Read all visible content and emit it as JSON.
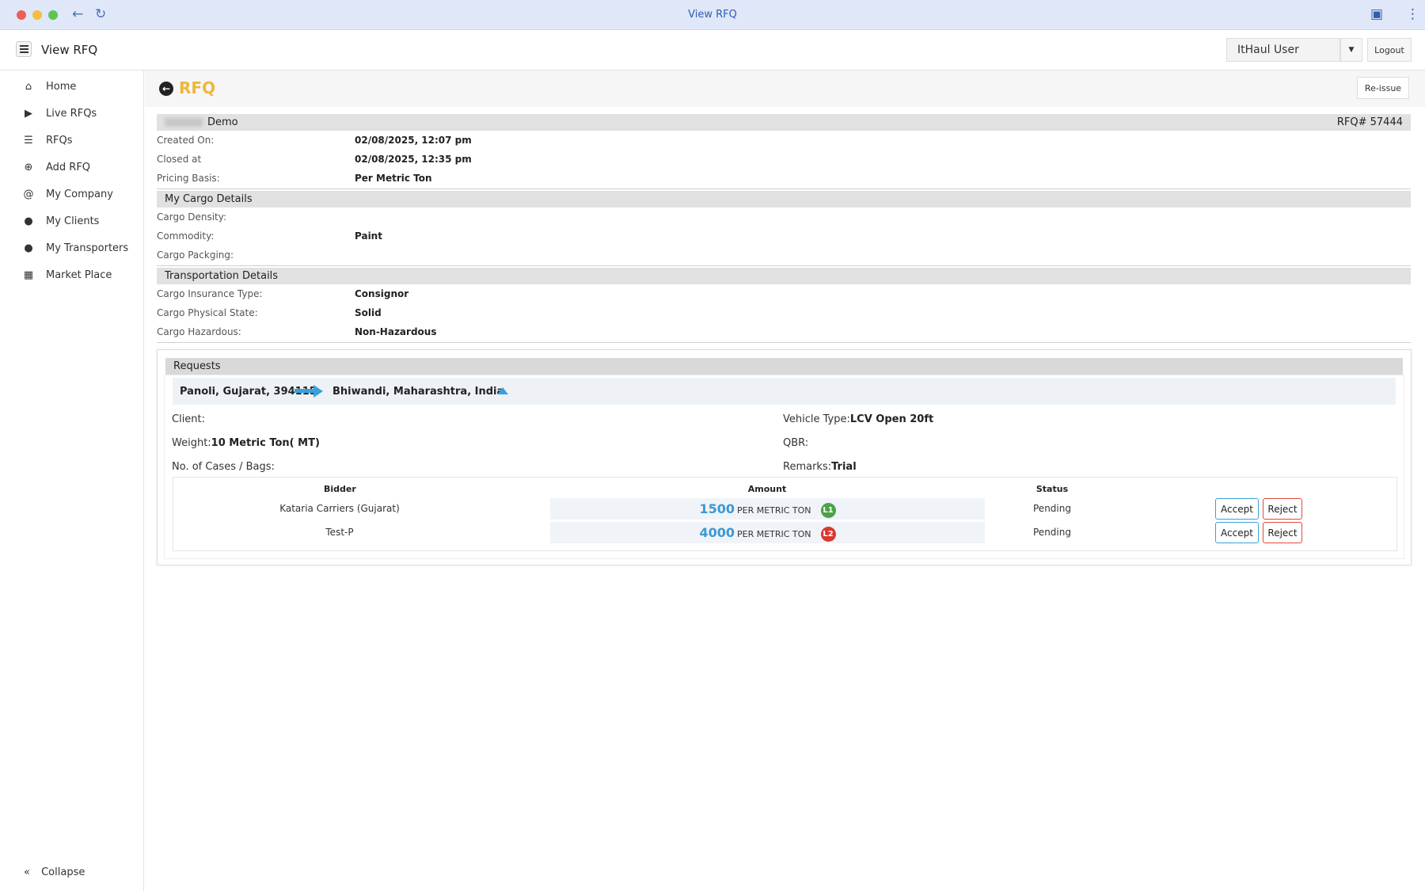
{
  "browser": {
    "title": "View RFQ"
  },
  "header": {
    "title": "View RFQ",
    "user": "ItHaul User",
    "logout_label": "Logout"
  },
  "sidebar": {
    "items": [
      {
        "label": "Home",
        "icon": "home-icon"
      },
      {
        "label": "Live RFQs",
        "icon": "play-icon"
      },
      {
        "label": "RFQs",
        "icon": "list-icon"
      },
      {
        "label": "Add RFQ",
        "icon": "plus-circle-icon"
      },
      {
        "label": "My Company",
        "icon": "at-icon"
      },
      {
        "label": "My Clients",
        "icon": "users-icon"
      },
      {
        "label": "My Transporters",
        "icon": "users-icon"
      },
      {
        "label": "Market Place",
        "icon": "map-icon"
      }
    ],
    "collapse_label": "Collapse"
  },
  "page": {
    "title": "RFQ",
    "reissue_label": "Re-issue"
  },
  "rfq": {
    "company_suffix": "Demo",
    "number": "RFQ# 57444",
    "created_label": "Created On:",
    "created_value": "02/08/2025, 12:07 pm",
    "closed_label": "Closed at",
    "closed_value": "02/08/2025, 12:35 pm",
    "pricing_label": "Pricing Basis:",
    "pricing_value": "Per Metric Ton"
  },
  "cargo": {
    "heading": "My Cargo Details",
    "density_label": "Cargo Density:",
    "density_value": "",
    "commodity_label": "Commodity:",
    "commodity_value": "Paint",
    "packaging_label": "Cargo Packging:",
    "packaging_value": ""
  },
  "transport": {
    "heading": "Transportation Details",
    "insurance_label": "Cargo Insurance Type:",
    "insurance_value": "Consignor",
    "state_label": "Cargo Physical State:",
    "state_value": "Solid",
    "hazard_label": "Cargo Hazardous:",
    "hazard_value": "Non-Hazardous"
  },
  "requests": {
    "heading": "Requests",
    "from": "Panoli, Gujarat, 394115",
    "to": "Bhiwandi, Maharashtra, India",
    "client_label": "Client:",
    "client_value": "",
    "vehicle_label": "Vehicle Type:",
    "vehicle_value": "LCV Open 20ft",
    "weight_label": "Weight:",
    "weight_value": "10 Metric Ton( MT)",
    "qbr_label": "QBR:",
    "qbr_value": "",
    "cases_label": "No. of Cases / Bags:",
    "cases_value": "",
    "remarks_label": "Remarks:",
    "remarks_value": "Trial",
    "columns": {
      "bidder": "Bidder",
      "amount": "Amount",
      "status": "Status"
    },
    "bids": [
      {
        "bidder": "Kataria Carriers (Gujarat)",
        "amount": "1500",
        "unit": "PER METRIC TON",
        "rank": "L1",
        "rank_color": "#4aa14a",
        "status": "Pending",
        "accept": "Accept",
        "reject": "Reject"
      },
      {
        "bidder": "Test-P",
        "amount": "4000",
        "unit": "PER METRIC TON",
        "rank": "L2",
        "rank_color": "#d8382f",
        "status": "Pending",
        "accept": "Accept",
        "reject": "Reject"
      }
    ]
  },
  "colors": {
    "accent": "#f0b63b",
    "link_blue": "#3a9ad4",
    "reject_red": "#e04a3a"
  }
}
